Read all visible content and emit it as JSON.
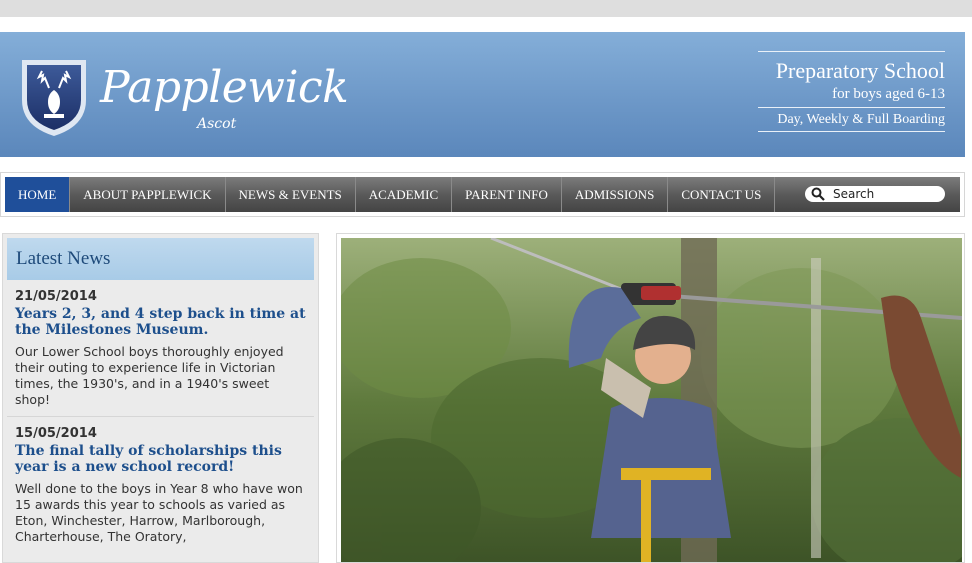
{
  "header": {
    "logo_name": "Papplewick",
    "logo_sub": "Ascot",
    "crest_icon": "stag-crest-icon",
    "tagline_1": "Preparatory School",
    "tagline_2": "for boys aged 6-13",
    "tagline_3": "Day, Weekly & Full Boarding"
  },
  "nav": {
    "items": [
      {
        "label": "HOME"
      },
      {
        "label": "ABOUT PAPPLEWICK"
      },
      {
        "label": "NEWS & EVENTS"
      },
      {
        "label": "ACADEMIC"
      },
      {
        "label": "PARENT INFO"
      },
      {
        "label": "ADMISSIONS"
      },
      {
        "label": "CONTACT US"
      }
    ],
    "active_index": 0,
    "search_placeholder": "Search"
  },
  "sidebar": {
    "heading": "Latest News",
    "news": [
      {
        "date": "21/05/2014",
        "title": "Years 2, 3, and 4 step back in time at the Milestones Museum.",
        "body": "Our Lower School boys thoroughly enjoyed their outing to experience life in Victorian times, the 1930's, and in a 1940's sweet shop!"
      },
      {
        "date": "15/05/2014",
        "title": "The final tally of scholarships this year is a new school record!",
        "body": "Well done to the boys in Year 8 who have won 15 awards this year to schools as varied as Eton, Winchester, Harrow, Marlborough, Charterhouse, The Oratory,"
      }
    ]
  },
  "colors": {
    "header_blue": "#6d98c8",
    "nav_active": "#1f4f9a",
    "news_title": "#1d4f8c"
  }
}
